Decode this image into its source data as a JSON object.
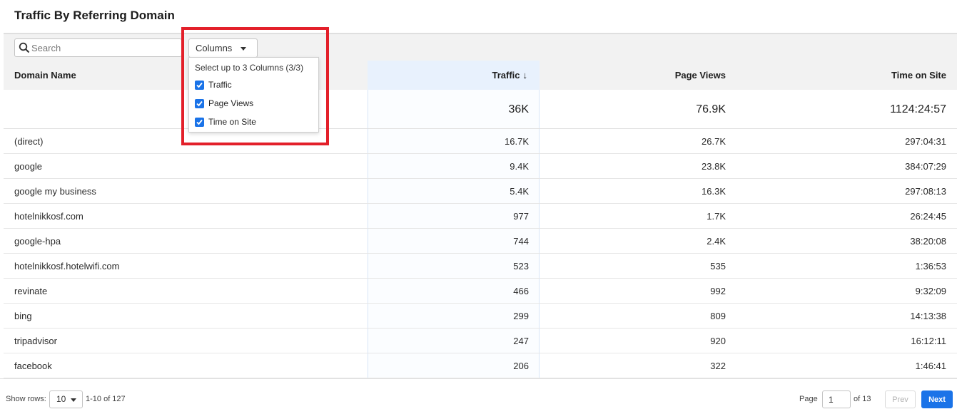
{
  "header": {
    "title": "Traffic By Referring Domain"
  },
  "toolbar": {
    "search_placeholder": "Search",
    "columns_label": "Columns"
  },
  "columns_menu": {
    "header": "Select up to 3 Columns (3/3)",
    "items": [
      {
        "label": "Traffic",
        "checked": true
      },
      {
        "label": "Page Views",
        "checked": true
      },
      {
        "label": "Time on Site",
        "checked": true
      }
    ]
  },
  "table": {
    "columns": {
      "domain": "Domain Name",
      "traffic": "Traffic",
      "pageviews": "Page Views",
      "time": "Time on Site"
    },
    "sort_icon": "↓",
    "totals": {
      "traffic": "36K",
      "pageviews": "76.9K",
      "time": "1124:24:57"
    },
    "rows": [
      {
        "domain": "(direct)",
        "traffic": "16.7K",
        "pageviews": "26.7K",
        "time": "297:04:31"
      },
      {
        "domain": "google",
        "traffic": "9.4K",
        "pageviews": "23.8K",
        "time": "384:07:29"
      },
      {
        "domain": "google my business",
        "traffic": "5.4K",
        "pageviews": "16.3K",
        "time": "297:08:13"
      },
      {
        "domain": "hotelnikkosf.com",
        "traffic": "977",
        "pageviews": "1.7K",
        "time": "26:24:45"
      },
      {
        "domain": "google-hpa",
        "traffic": "744",
        "pageviews": "2.4K",
        "time": "38:20:08"
      },
      {
        "domain": "hotelnikkosf.hotelwifi.com",
        "traffic": "523",
        "pageviews": "535",
        "time": "1:36:53"
      },
      {
        "domain": "revinate",
        "traffic": "466",
        "pageviews": "992",
        "time": "9:32:09"
      },
      {
        "domain": "bing",
        "traffic": "299",
        "pageviews": "809",
        "time": "14:13:38"
      },
      {
        "domain": "tripadvisor",
        "traffic": "247",
        "pageviews": "920",
        "time": "16:12:11"
      },
      {
        "domain": "facebook",
        "traffic": "206",
        "pageviews": "322",
        "time": "1:46:41"
      }
    ]
  },
  "footer": {
    "show_rows_label": "Show rows:",
    "rows_per_page": "10",
    "range": "1-10 of 127",
    "page_label": "Page",
    "page_value": "1",
    "of_pages": "of 13",
    "prev_label": "Prev",
    "next_label": "Next"
  },
  "colors": {
    "accent": "#1a73e8",
    "highlight": "#e3202a",
    "sorted_column": "#e8f1fd"
  }
}
